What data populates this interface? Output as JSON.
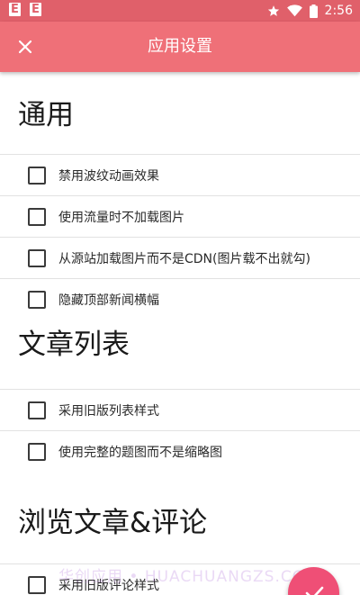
{
  "status_bar": {
    "time": "2:56",
    "notification_icons": [
      "E",
      "E"
    ]
  },
  "toolbar": {
    "title": "应用设置",
    "close_icon": "close-icon"
  },
  "sections": [
    {
      "title": "通用",
      "items": [
        {
          "label": "禁用波纹动画效果",
          "checked": false
        },
        {
          "label": "使用流量时不加载图片",
          "checked": false
        },
        {
          "label": "从源站加载图片而不是CDN(图片载不出就勾)",
          "checked": false
        },
        {
          "label": "隐藏顶部新闻横幅",
          "checked": false
        }
      ]
    },
    {
      "title": "文章列表",
      "items": [
        {
          "label": "采用旧版列表样式",
          "checked": false
        },
        {
          "label": "使用完整的题图而不是缩略图",
          "checked": false
        }
      ]
    },
    {
      "title": "浏览文章&评论",
      "items": [
        {
          "label": "采用旧版评论样式",
          "checked": false
        }
      ]
    }
  ],
  "fab": {
    "icon": "check-icon"
  },
  "watermark": "华创应用 • HUACHUANGZS.COM",
  "colors": {
    "status_bar": "#e0606a",
    "toolbar": "#ef7078",
    "fab": "#ef4f76",
    "divider": "#e2e2e2"
  }
}
